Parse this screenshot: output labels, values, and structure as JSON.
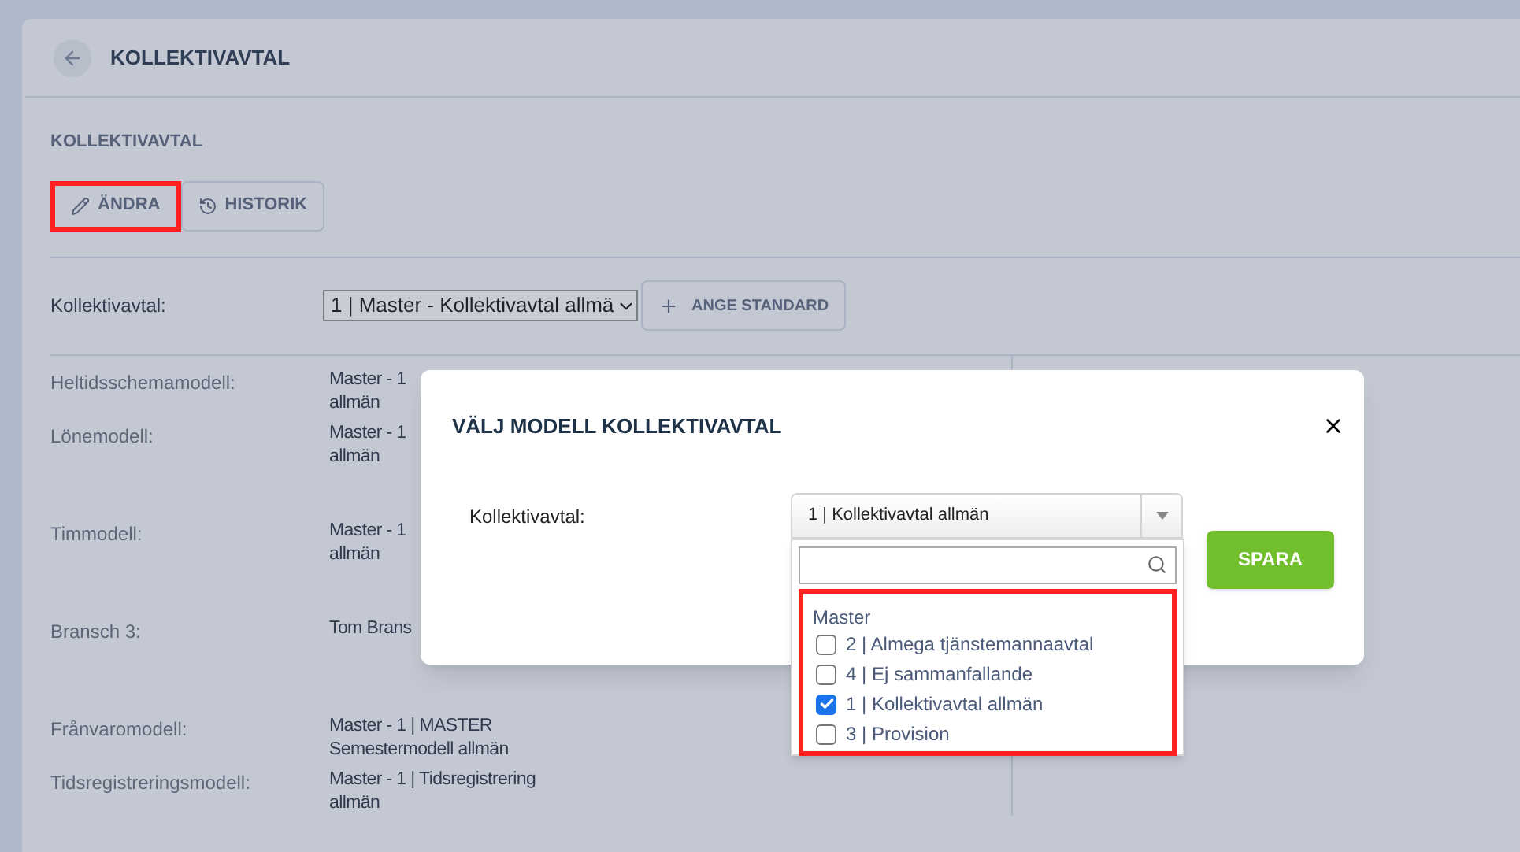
{
  "page": {
    "title": "KOLLEKTIVAVTAL",
    "section_title": "KOLLEKTIVAVTAL"
  },
  "actions": [
    {
      "label": "ÄNDRA",
      "kind": "edit",
      "highlighted": true
    },
    {
      "label": "HISTORIK",
      "kind": "history",
      "highlighted": false
    }
  ],
  "agreement": {
    "label": "Kollektivavtal:",
    "value": "1 | Master - Kollektivavtal allmä",
    "set_default": "ANGE STANDARD"
  },
  "models": [
    {
      "label": "Heltidsschemamodell:",
      "lines": [
        "Master - 1",
        "allmän"
      ]
    },
    {
      "label": "Lönemodell:",
      "lines": [
        "Master - 1",
        "allmän"
      ]
    },
    {
      "label": "Timmodell:",
      "lines": [
        "Master - 1",
        "allmän"
      ]
    },
    {
      "label": "Bransch 3:",
      "lines": [
        "Tom Brans"
      ]
    },
    {
      "label": "Frånvaromodell:",
      "lines": [
        "Master - 1 | MASTER",
        "Semestermodell allmän"
      ]
    },
    {
      "label": "Tidsregistreringsmodell:",
      "lines": [
        "Master - 1 | Tidsregistrering",
        "allmän"
      ]
    }
  ],
  "dialog": {
    "title": "VÄLJ MODELL KOLLEKTIVAVTAL",
    "field_label": "Kollektivavtal:",
    "select_value": "1 | Kollektivavtal allmän",
    "save": "SPARA",
    "dropdown": {
      "highlighted": true,
      "group": "Master",
      "options": [
        {
          "label": "2 | Almega tjänstemannaavtal",
          "checked": false
        },
        {
          "label": "4 | Ej sammanfallande",
          "checked": false
        },
        {
          "label": "1 | Kollektivavtal allmän",
          "checked": true
        },
        {
          "label": "3 | Provision",
          "checked": false
        }
      ]
    }
  }
}
